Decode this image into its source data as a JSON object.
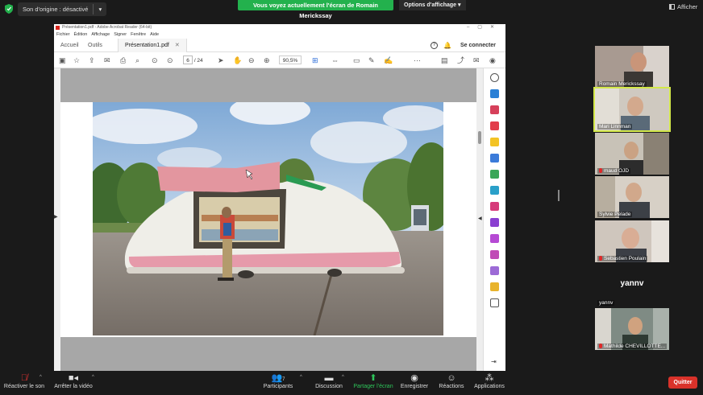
{
  "topbar": {
    "original_sound_label": "Son d'origine : désactivé",
    "share_banner": "Vous voyez actuellement l'écran de Romain Merickssay",
    "view_options": "Options d'affichage",
    "afficher": "Afficher"
  },
  "acrobat": {
    "window_title": "Présentation1.pdf - Adobe Acrobat Reader (64-bit)",
    "menu": [
      "Fichier",
      "Édition",
      "Affichage",
      "Signer",
      "Fenêtre",
      "Aide"
    ],
    "tabs": {
      "home": "Accueil",
      "tools": "Outils",
      "document": "Présentation1.pdf"
    },
    "connect": "Se connecter",
    "page_current": "6",
    "page_total": "/ 24",
    "zoom": "90,5%"
  },
  "participants": [
    {
      "name": "Romain Merickssay",
      "muted": false,
      "camera": true
    },
    {
      "name": "Mari Linnman",
      "muted": false,
      "camera": true,
      "speaking": true
    },
    {
      "name": "maud OJD",
      "muted": true,
      "camera": true
    },
    {
      "name": "Sylvie Pelade",
      "muted": false,
      "camera": true
    },
    {
      "name": "Sebastien Poulain",
      "muted": true,
      "camera": true
    },
    {
      "name": "yannv",
      "muted": false,
      "camera": false
    },
    {
      "name": "Mathilde CHEVILLOTTE...",
      "muted": true,
      "camera": true
    }
  ],
  "bottombar": {
    "unmute": "Réactiver le son",
    "stop_video": "Arrêter la vidéo",
    "participants": "Participants",
    "participants_count": "7",
    "chat": "Discussion",
    "share": "Partager l'écran",
    "record": "Enregistrer",
    "reactions": "Réactions",
    "apps": "Applications",
    "quit": "Quitter"
  },
  "colors": {
    "share_green": "#23b14d",
    "quit_red": "#d9322a",
    "active_speaker": "#d3e84a"
  }
}
